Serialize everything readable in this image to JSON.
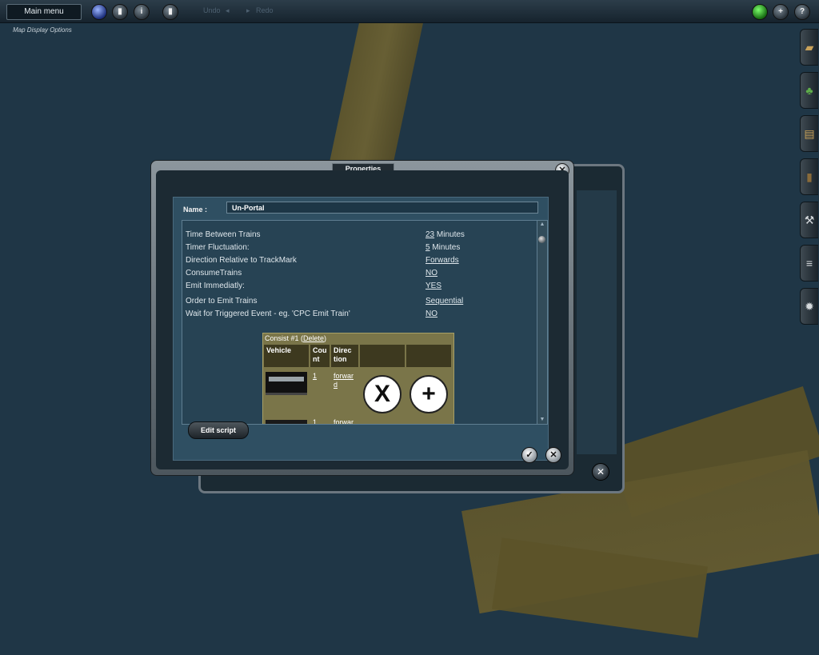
{
  "toolbar": {
    "main_menu": "Main menu",
    "undo": "Undo",
    "redo": "Redo",
    "map_display_options": "Map Display Options"
  },
  "dialog": {
    "title": "Properties",
    "name_label": "Name :",
    "name_value": "Un-Portal",
    "properties": [
      {
        "label": "Time Between Trains",
        "value": "23",
        "suffix": " Minutes"
      },
      {
        "label": "Timer Fluctuation:",
        "value": "5",
        "suffix": " Minutes"
      },
      {
        "label": "Direction Relative to TrackMark",
        "value": "Forwards",
        "suffix": ""
      },
      {
        "label": "ConsumeTrains",
        "value": "NO",
        "suffix": ""
      },
      {
        "label": "Emit Immediatly:",
        "value": "YES",
        "suffix": ""
      },
      {
        "label": "Order to Emit Trains",
        "value": "Sequential",
        "suffix": ""
      },
      {
        "label": "Wait for Triggered Event - eg. 'CPC Emit Train'",
        "value": "NO",
        "suffix": ""
      }
    ],
    "consist": {
      "title": "Consist #1 (",
      "delete": "Delete",
      "title_end": ")",
      "headers": [
        "Vehicle",
        "Cou nt",
        "Direc tion"
      ],
      "rows": [
        {
          "count": "1",
          "direction": "forwar d"
        }
      ],
      "partial_row": {
        "count": "1",
        "direction": "forwar"
      }
    },
    "edit_script": "Edit script"
  },
  "icons": {
    "close": "✕",
    "ok": "✓",
    "remove": "X",
    "add": "+"
  }
}
